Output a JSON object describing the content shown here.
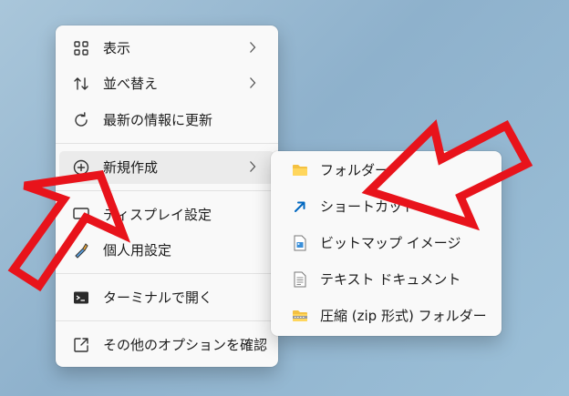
{
  "context_menu": {
    "items": [
      {
        "label": "表示",
        "icon": "grid-view-icon"
      },
      {
        "label": "並べ替え",
        "icon": "sort-icon"
      },
      {
        "label": "最新の情報に更新",
        "icon": "refresh-icon"
      },
      {
        "label": "新規作成",
        "icon": "add-circle-icon"
      },
      {
        "label": "ディスプレイ設定",
        "icon": "display-settings-icon"
      },
      {
        "label": "個人用設定",
        "icon": "personalize-icon"
      },
      {
        "label": "ターミナルで開く",
        "icon": "terminal-icon"
      },
      {
        "label": "その他のオプションを確認",
        "icon": "more-options-icon"
      }
    ]
  },
  "new_submenu": {
    "items": [
      {
        "label": "フォルダー",
        "icon": "folder-icon"
      },
      {
        "label": "ショートカット",
        "icon": "shortcut-icon"
      },
      {
        "label": "ビットマップ イメージ",
        "icon": "bitmap-image-icon"
      },
      {
        "label": "テキスト ドキュメント",
        "icon": "text-document-icon"
      },
      {
        "label": "圧縮 (zip 形式) フォルダー",
        "icon": "zip-folder-icon"
      }
    ]
  },
  "colors": {
    "accent": "#0067c0",
    "highlight_arrow": "#e8131b",
    "folder": "#f4c142"
  }
}
